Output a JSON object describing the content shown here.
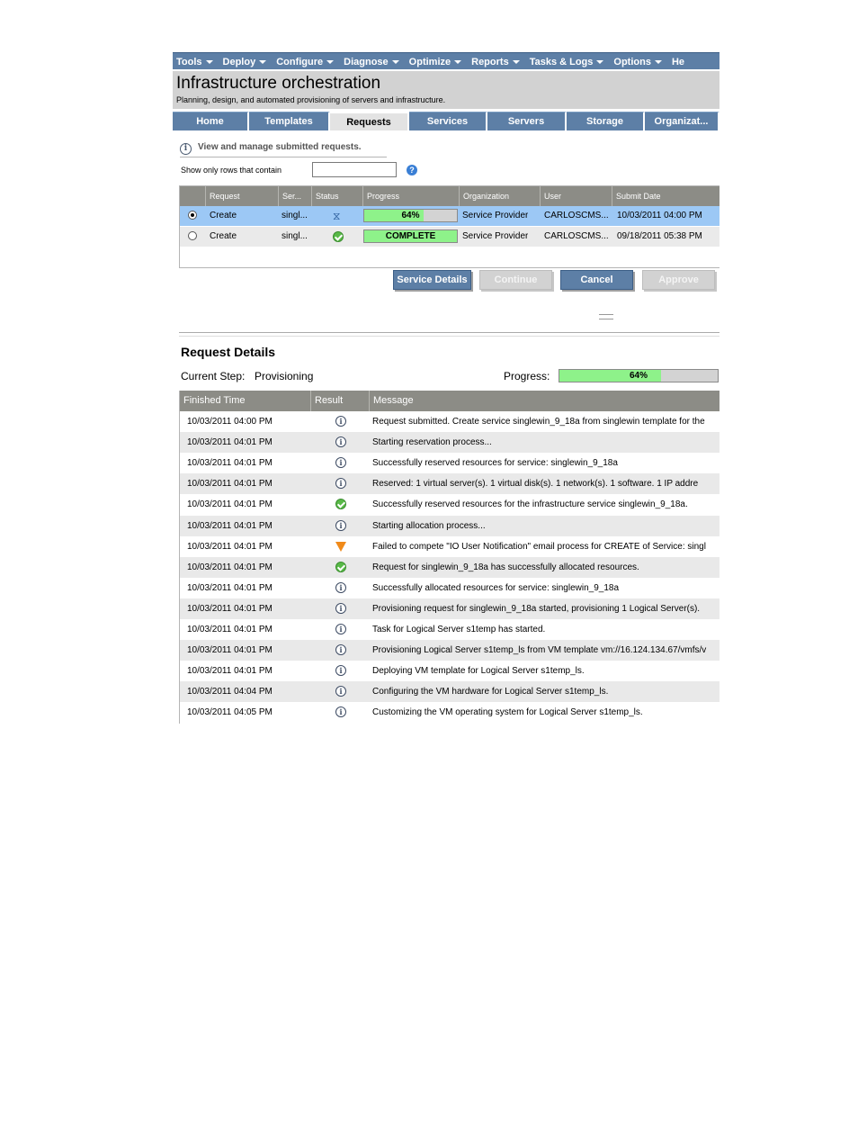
{
  "menubar": {
    "items": [
      "Tools",
      "Deploy",
      "Configure",
      "Diagnose",
      "Optimize",
      "Reports",
      "Tasks & Logs",
      "Options",
      "He"
    ]
  },
  "header": {
    "title": "Infrastructure orchestration",
    "subtitle": "Planning, design, and automated provisioning of servers and infrastructure."
  },
  "tabs": [
    "Home",
    "Templates",
    "Requests",
    "Services",
    "Servers",
    "Storage",
    "Organizat..."
  ],
  "active_tab": "Requests",
  "info_text": "View and manage submitted requests.",
  "filter": {
    "label": "Show only rows that contain",
    "value": "",
    "help_icon": "?"
  },
  "requests": {
    "columns": [
      "Request",
      "Ser...",
      "Status",
      "Progress",
      "Organization",
      "User",
      "Submit Date"
    ],
    "rows": [
      {
        "selected": true,
        "request": "Create",
        "service": "singl...",
        "status": "in-progress",
        "progress": 0.64,
        "progress_text": "64%",
        "organization": "Service Provider",
        "user": "CARLOSCMS...",
        "submit_date": "10/03/2011 04:00 PM"
      },
      {
        "selected": false,
        "request": "Create",
        "service": "singl...",
        "status": "complete",
        "progress": 1.0,
        "progress_text": "COMPLETE",
        "organization": "Service Provider",
        "user": "CARLOSCMS...",
        "submit_date": "09/18/2011 05:38 PM"
      }
    ]
  },
  "buttons": {
    "service_details": "Service Details",
    "continue": "Continue",
    "cancel": "Cancel",
    "approve": "Approve"
  },
  "details": {
    "title": "Request Details",
    "current_step_label": "Current Step:",
    "current_step": "Provisioning",
    "progress_label": "Progress:",
    "progress": 0.64,
    "progress_text": "64%",
    "columns": [
      "Finished Time",
      "Result",
      "Message"
    ],
    "rows": [
      {
        "time": "10/03/2011 04:00 PM",
        "result": "info",
        "message": "Request submitted. Create service singlewin_9_18a from singlewin template for the"
      },
      {
        "time": "10/03/2011 04:01 PM",
        "result": "info",
        "message": "Starting reservation process..."
      },
      {
        "time": "10/03/2011 04:01 PM",
        "result": "info",
        "message": "Successfully reserved resources for service: singlewin_9_18a"
      },
      {
        "time": "10/03/2011 04:01 PM",
        "result": "info",
        "message": "Reserved: 1 virtual server(s). 1 virtual disk(s). 1 network(s). 1 software. 1 IP addre"
      },
      {
        "time": "10/03/2011 04:01 PM",
        "result": "ok",
        "message": "Successfully reserved resources for the infrastructure service singlewin_9_18a."
      },
      {
        "time": "10/03/2011 04:01 PM",
        "result": "info",
        "message": "Starting allocation process..."
      },
      {
        "time": "10/03/2011 04:01 PM",
        "result": "warn",
        "message": "Failed to compete \"IO User Notification\" email process for CREATE of Service: singl"
      },
      {
        "time": "10/03/2011 04:01 PM",
        "result": "ok",
        "message": "Request for singlewin_9_18a has successfully allocated resources."
      },
      {
        "time": "10/03/2011 04:01 PM",
        "result": "info",
        "message": "Successfully allocated resources for service: singlewin_9_18a"
      },
      {
        "time": "10/03/2011 04:01 PM",
        "result": "info",
        "message": "Provisioning request for singlewin_9_18a started, provisioning 1 Logical Server(s)."
      },
      {
        "time": "10/03/2011 04:01 PM",
        "result": "info",
        "message": "Task for Logical Server s1temp has started."
      },
      {
        "time": "10/03/2011 04:01 PM",
        "result": "info",
        "message": "Provisioning Logical Server s1temp_ls from VM template vm://16.124.134.67/vmfs/v"
      },
      {
        "time": "10/03/2011 04:01 PM",
        "result": "info",
        "message": "Deploying VM template for Logical Server s1temp_ls."
      },
      {
        "time": "10/03/2011 04:04 PM",
        "result": "info",
        "message": "Configuring the VM hardware for Logical Server s1temp_ls."
      },
      {
        "time": "10/03/2011 04:05 PM",
        "result": "info",
        "message": "Customizing the VM operating system for Logical Server s1temp_ls."
      }
    ]
  },
  "colors": {
    "nav": "#5d7fa6",
    "grid_header": "#8c8c86",
    "selected_row": "#9cc8f5",
    "progress_fill": "#8ef28a",
    "warn": "#f08a1a",
    "ok": "#58b947"
  },
  "icons": {
    "info": "info-icon",
    "ok": "check-circle-icon",
    "warn": "warning-triangle-icon",
    "in_progress": "hourglass-icon"
  }
}
